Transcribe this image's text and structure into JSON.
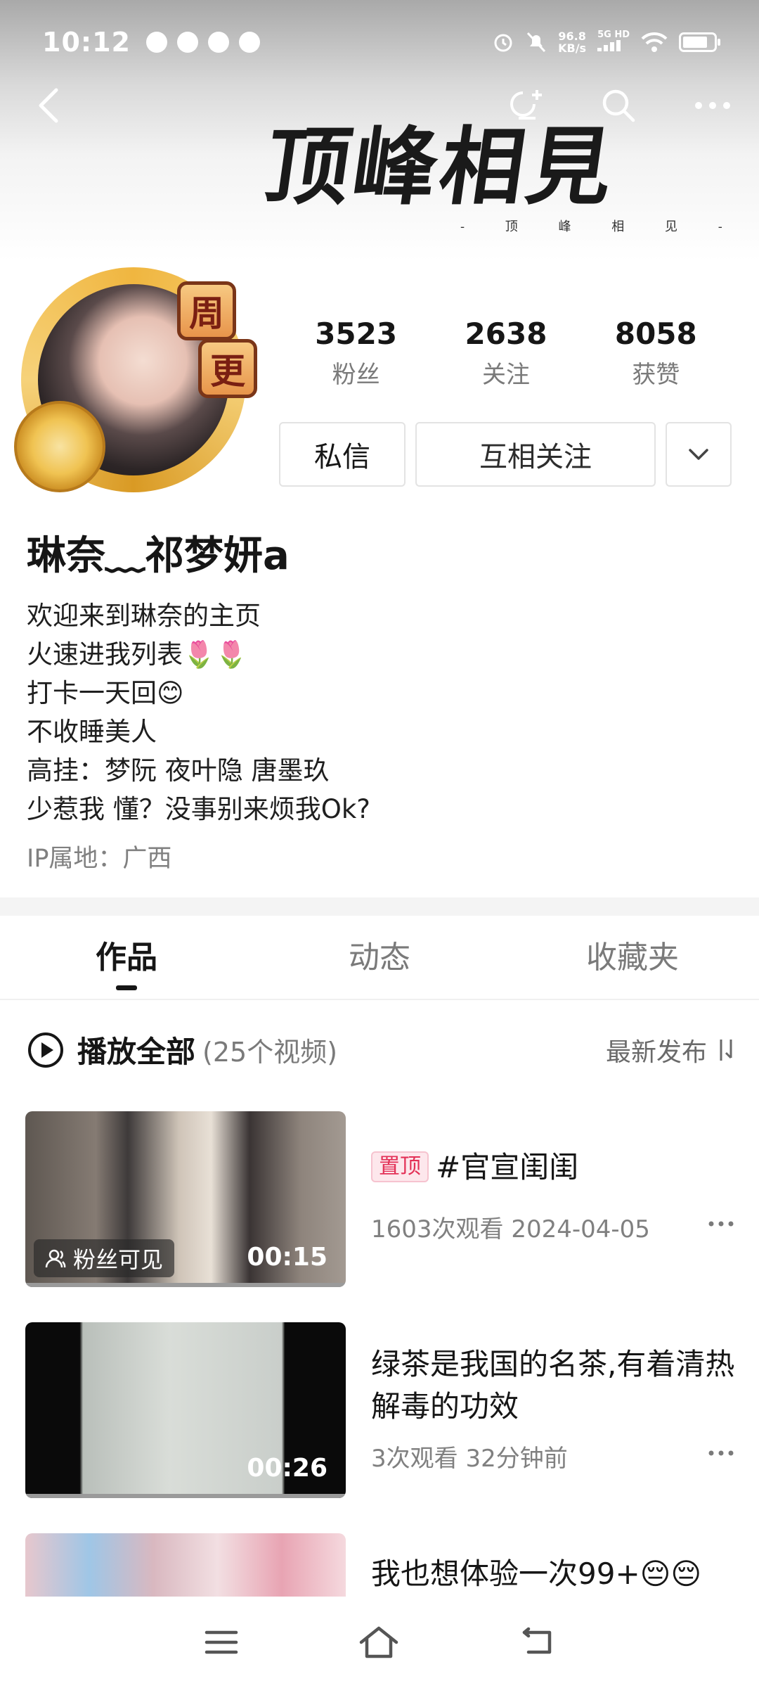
{
  "status_bar": {
    "time": "10:12",
    "net_speed_value": "96.8",
    "net_speed_unit": "KB/s",
    "signal_label": "5G HD"
  },
  "banner": {
    "calligraphy": "顶峰相見",
    "subtitle": "- 顶 峰 相 见 -"
  },
  "avatar": {
    "badge_top": "周",
    "badge_bottom": "更"
  },
  "stats": [
    {
      "value": "3523",
      "label": "粉丝"
    },
    {
      "value": "2638",
      "label": "关注"
    },
    {
      "value": "8058",
      "label": "获赞"
    }
  ],
  "actions": {
    "message": "私信",
    "mutual_follow": "互相关注"
  },
  "profile": {
    "nickname": "琳奈﹏祁梦妍a",
    "bio_lines": [
      "欢迎来到琳奈的主页",
      "火速进我列表🌷🌷",
      "打卡一天回😊",
      "不收睡美人",
      "高挂：梦阮 夜叶隐 唐墨玖",
      "少惹我 懂？没事别来烦我Ok?"
    ],
    "ip": "IP属地：广西"
  },
  "tabs": [
    {
      "label": "作品",
      "active": true
    },
    {
      "label": "动态",
      "active": false
    },
    {
      "label": "收藏夹",
      "active": false
    }
  ],
  "play_all": {
    "label": "播放全部",
    "count": "(25个视频)",
    "sort_label": "最新发布"
  },
  "videos": [
    {
      "pinned_label": "置顶",
      "title": "#官宣闺闺",
      "meta": "1603次观看  2024-04-05",
      "duration": "00:15",
      "visibility": "粉丝可见"
    },
    {
      "title": "绿茶是我国的名茶,有着清热解毒的功效",
      "meta": "3次观看  32分钟前",
      "duration": "00:26"
    },
    {
      "title": "我也想体验一次99+😔😔"
    }
  ],
  "colors": {
    "pin_text": "#e33157",
    "pin_bg": "#fde7ec",
    "muted": "#7a7a7a",
    "avatar_frame": "#f0b640"
  }
}
